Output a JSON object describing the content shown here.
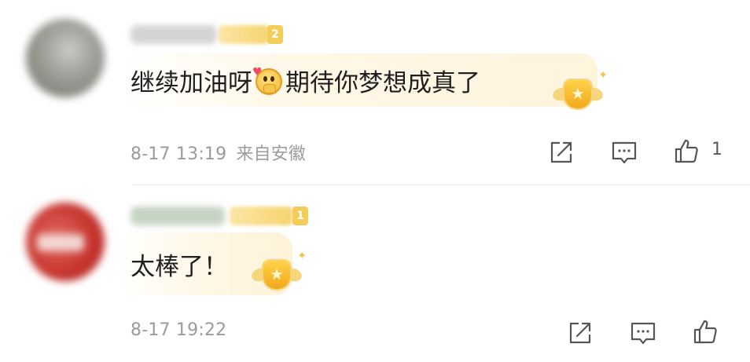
{
  "comments": [
    {
      "text_before": "继续加油呀",
      "text_after": "期待你梦想成真了",
      "emoji": "hugging-face-emoji",
      "level": "2",
      "date": "8-17 13:19",
      "location": "来自安徽",
      "like_count": "1",
      "badge": "star-badge"
    },
    {
      "text": "太棒了！",
      "level": "1",
      "date": "8-17 19:22",
      "badge": "star-badge"
    }
  ],
  "colors": {
    "bubble": "#fff4dc",
    "meta": "#9b9b9b",
    "badge": "#f1a91b"
  }
}
